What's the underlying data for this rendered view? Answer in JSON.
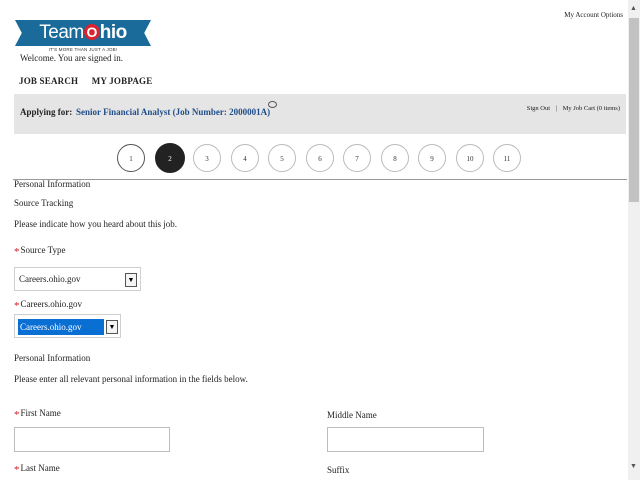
{
  "header": {
    "logo": {
      "team": "Team",
      "o": "O",
      "hio": "hio",
      "tagline": "IT'S MORE THAN JUST A JOB!"
    },
    "account_options": "My Account Options",
    "welcome": "Welcome. You are signed in."
  },
  "topnav": {
    "items": [
      "JOB SEARCH",
      "MY JOBPAGE"
    ]
  },
  "apply": {
    "label": "Applying for:",
    "job": "Senior Financial Analyst (Job Number: 2000001A)",
    "sign_out": "Sign Out",
    "separator": "|",
    "cart": "My Job Cart (0 items)"
  },
  "steps": {
    "items": [
      "1",
      "2",
      "3",
      "4",
      "5",
      "6",
      "7",
      "8",
      "9",
      "10",
      "11"
    ],
    "active": "2"
  },
  "section1": {
    "title": "Personal Information",
    "subtitle": "Source Tracking",
    "instruction": "Please indicate how you heard about this job.",
    "asterisk": "*",
    "source_type_label": "Source Type",
    "source_type_value": "Careers.ohio.gov",
    "careers_label": "Careers.ohio.gov",
    "careers_value": "Careers.ohio.gov"
  },
  "section2": {
    "title": "Personal Information",
    "instruction": "Please enter all relevant personal information in the fields below.",
    "first_name_label": "First Name",
    "middle_name_label": "Middle Name",
    "last_name_label": "Last Name",
    "suffix_label": "Suffix"
  },
  "scrollbar": {
    "up": "▲",
    "down": "▼"
  }
}
